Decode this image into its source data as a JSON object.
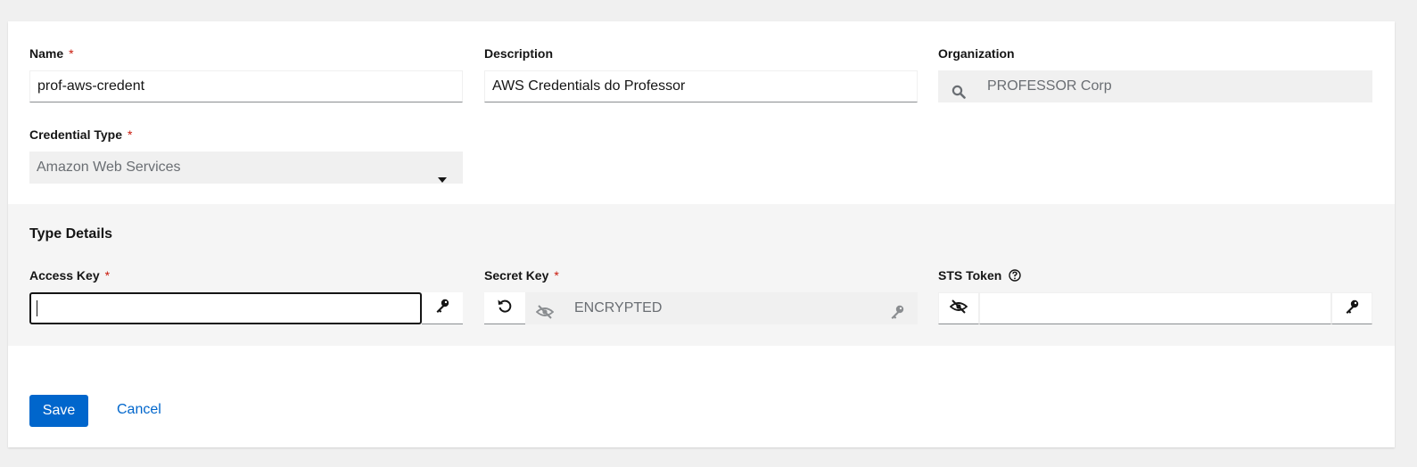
{
  "form": {
    "name": {
      "label": "Name",
      "required_mark": "*",
      "value": "prof-aws-credent"
    },
    "description": {
      "label": "Description",
      "value": "AWS Credentials do Professor"
    },
    "organization": {
      "label": "Organization",
      "value": "PROFESSOR Corp",
      "icon": "search-icon"
    },
    "credential_type": {
      "label": "Credential Type",
      "required_mark": "*",
      "value": "Amazon Web Services",
      "icon": "caret-down-icon"
    }
  },
  "type_details": {
    "title": "Type Details",
    "access_key": {
      "label": "Access Key",
      "required_mark": "*",
      "value": "",
      "icon": "key-icon"
    },
    "secret_key": {
      "label": "Secret Key",
      "required_mark": "*",
      "value": "ENCRYPTED",
      "icons": [
        "undo-icon",
        "eye-slash-icon",
        "key-icon"
      ]
    },
    "sts_token": {
      "label": "STS Token",
      "help_icon": "question-circle-icon",
      "value": "",
      "icons": [
        "eye-slash-icon",
        "key-icon"
      ]
    }
  },
  "actions": {
    "save_label": "Save",
    "cancel_label": "Cancel"
  },
  "colors": {
    "primary": "#0066cc",
    "required": "#c9190b",
    "disabled_bg": "#f0f0f0",
    "section_bg": "#f5f5f5"
  }
}
